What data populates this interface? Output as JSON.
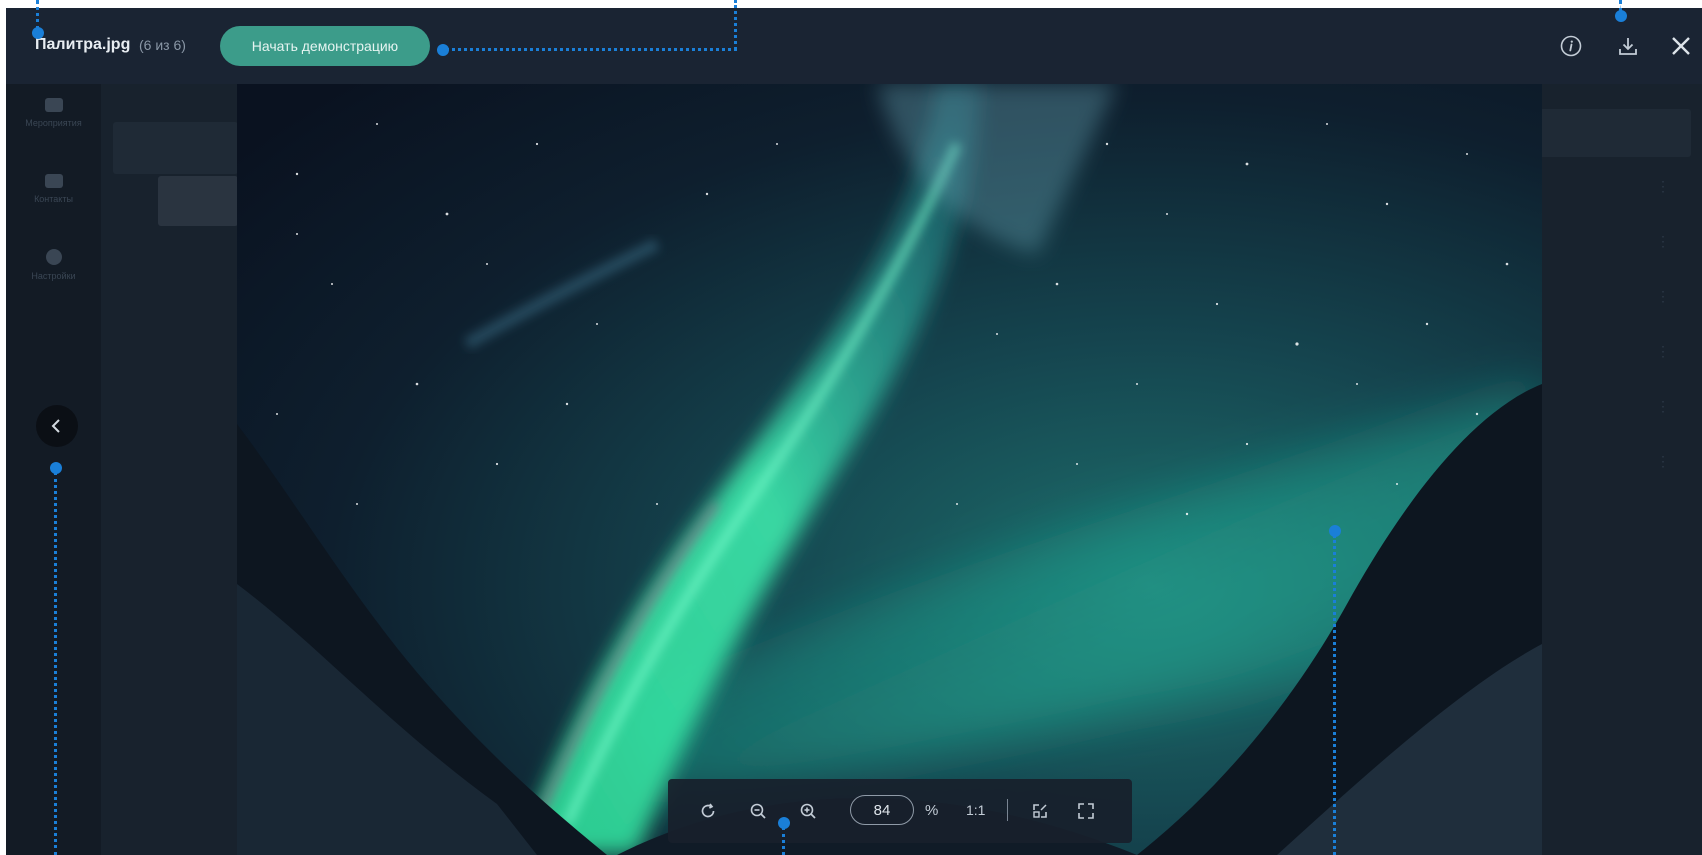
{
  "topbar": {
    "title": "Палитра.jpg",
    "counter": "(6 из 6)",
    "demo_button": "Начать демонстрацию"
  },
  "sidebar": {
    "items": [
      {
        "label": "Мероприятия",
        "icon": "calendar-icon"
      },
      {
        "label": "Контакты",
        "icon": "contacts-icon"
      },
      {
        "label": "Настройки",
        "icon": "settings-icon"
      }
    ]
  },
  "zoom": {
    "value": "84",
    "unit": "%",
    "actual_size": "1:1"
  },
  "icons": {
    "info": "info-icon",
    "download": "download-icon",
    "close": "close-icon",
    "prev": "chevron-left-icon",
    "rotate": "rotate-icon",
    "zoom_out": "zoom-out-icon",
    "zoom_in": "zoom-in-icon",
    "fit": "fit-screen-icon",
    "fullscreen": "fullscreen-icon"
  },
  "colors": {
    "accent": "#3c9c8a",
    "annotation": "#1a7fd8",
    "background": "#17202c"
  }
}
